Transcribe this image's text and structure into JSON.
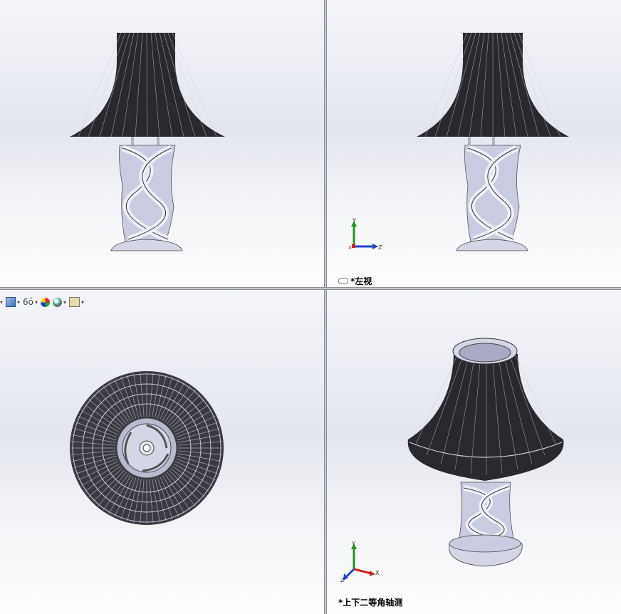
{
  "viewports": {
    "top_left": {
      "label": ""
    },
    "top_right": {
      "label": "*左视",
      "label_icon": "link-icon"
    },
    "bottom_left": {
      "label": ""
    },
    "bottom_right": {
      "label": "*上下二等角轴测"
    }
  },
  "triad": {
    "top_right": {
      "x": "Z",
      "y": "Y",
      "z": "X"
    },
    "bottom_right": {
      "x": "X",
      "y": "Y",
      "z": "Z"
    }
  },
  "heads_up_toolbar": {
    "items": [
      "dropdown-caret",
      "view-orientation-icon",
      "display-style-icon",
      "hide-show-items-icon",
      "edit-appearance-icon",
      "apply-scene-icon",
      "view-settings-icon"
    ]
  },
  "colors": {
    "shade_dark": "#1a1a1a",
    "body_light": "#c9cbe0",
    "accent_red": "#d02020",
    "accent_green": "#1a9a1a",
    "accent_blue": "#2040d0"
  }
}
